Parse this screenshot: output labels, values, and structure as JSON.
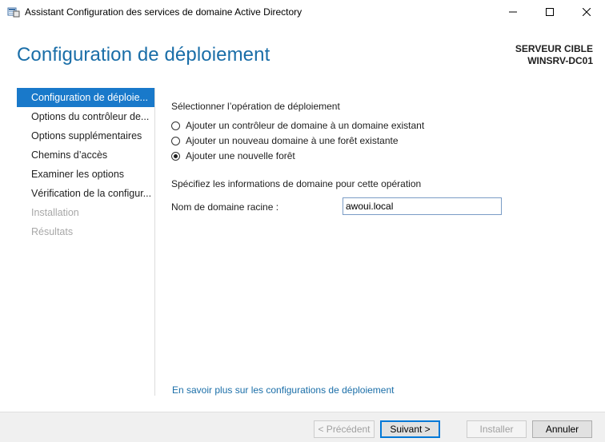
{
  "window": {
    "title": "Assistant Configuration des services de domaine Active Directory",
    "icon": "server-manager-icon",
    "controls": [
      "minimize-icon",
      "maximize-icon",
      "close-icon"
    ]
  },
  "header": {
    "page_title": "Configuration de déploiement",
    "target_label": "SERVEUR CIBLE",
    "target_name": "WINSRV-DC01"
  },
  "nav": {
    "items": [
      {
        "label": "Configuration de déploie...",
        "state": "active"
      },
      {
        "label": "Options du contrôleur de...",
        "state": "enabled"
      },
      {
        "label": "Options supplémentaires",
        "state": "enabled"
      },
      {
        "label": "Chemins d’accès",
        "state": "enabled"
      },
      {
        "label": "Examiner les options",
        "state": "enabled"
      },
      {
        "label": "Vérification de la configur...",
        "state": "enabled"
      },
      {
        "label": "Installation",
        "state": "disabled"
      },
      {
        "label": "Résultats",
        "state": "disabled"
      }
    ]
  },
  "content": {
    "operation_heading": "Sélectionner l’opération de déploiement",
    "options": [
      {
        "label": "Ajouter un contrôleur de domaine à un domaine existant",
        "selected": false
      },
      {
        "label": "Ajouter un nouveau domaine à une forêt existante",
        "selected": false
      },
      {
        "label": "Ajouter une nouvelle forêt",
        "selected": true
      }
    ],
    "domain_heading": "Spécifiez les informations de domaine pour cette opération",
    "root_domain_label": "Nom de domaine racine :",
    "root_domain_value": "awoui.local",
    "learn_more_link": "En savoir plus sur les configurations de déploiement"
  },
  "footer": {
    "previous": "< Précédent",
    "next": "Suivant >",
    "install": "Installer",
    "cancel": "Annuler"
  },
  "colors": {
    "accent": "#1979ca",
    "title_blue": "#1a6ea8",
    "disabled_text": "#a8a8a8"
  }
}
